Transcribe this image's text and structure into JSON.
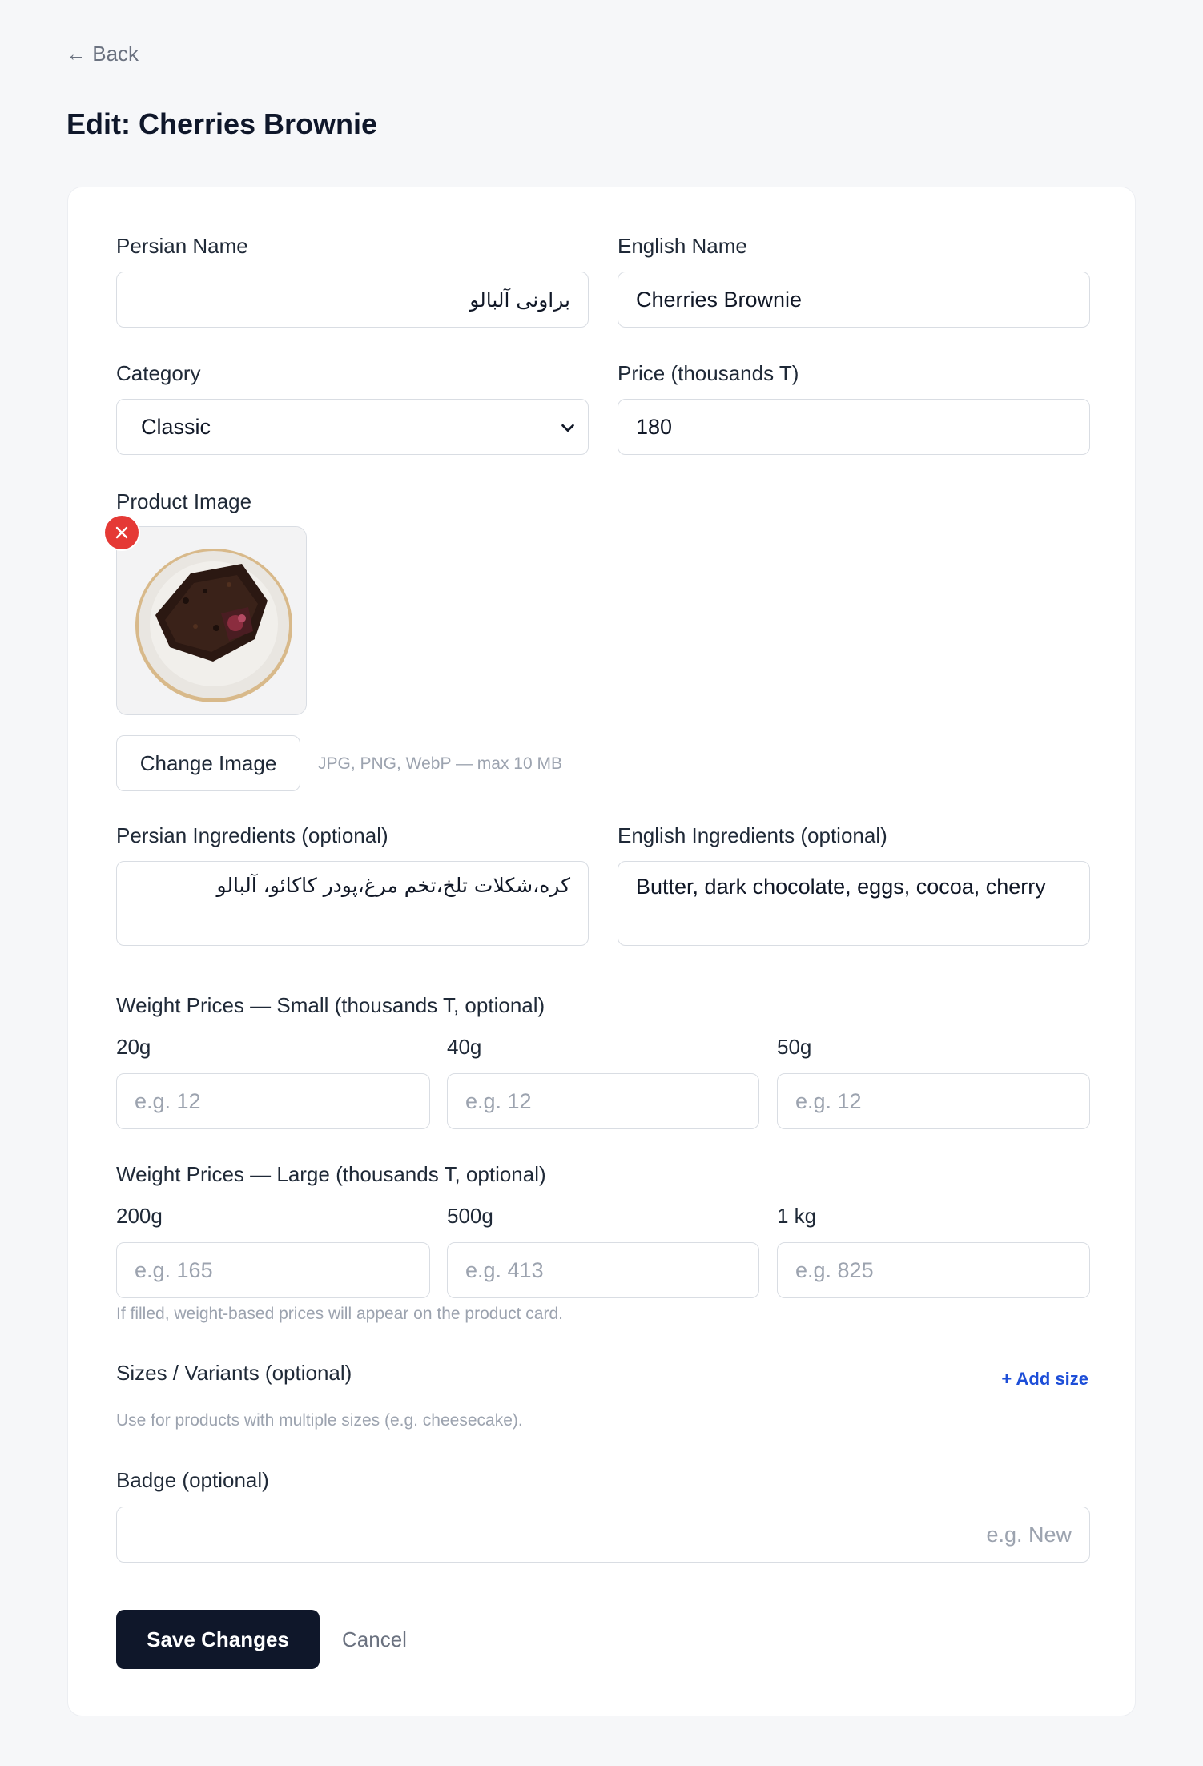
{
  "nav": {
    "back_label": "← Back"
  },
  "page": {
    "title": "Edit: Cherries Brownie"
  },
  "form": {
    "persian_name": {
      "label": "Persian Name",
      "value": "براونی آلبالو"
    },
    "english_name": {
      "label": "English Name",
      "value": "Cherries Brownie"
    },
    "category": {
      "label": "Category",
      "value": "Classic"
    },
    "price": {
      "label": "Price (thousands T)",
      "value": "180"
    },
    "product_image": {
      "label": "Product Image",
      "change_button": "Change Image",
      "hint": "JPG, PNG, WebP — max 10 MB"
    },
    "persian_ingredients": {
      "label": "Persian Ingredients (optional)",
      "value": "کره،شکلات تلخ،تخم مرغ،پودر کاکائو، آلبالو"
    },
    "english_ingredients": {
      "label": "English Ingredients (optional)",
      "value": "Butter, dark chocolate, eggs, cocoa, cherry"
    },
    "weight_small": {
      "label": "Weight Prices — Small (thousands T, optional)",
      "fields": [
        {
          "label": "20g",
          "placeholder": "e.g. 12"
        },
        {
          "label": "40g",
          "placeholder": "e.g. 12"
        },
        {
          "label": "50g",
          "placeholder": "e.g. 12"
        }
      ]
    },
    "weight_large": {
      "label": "Weight Prices — Large (thousands T, optional)",
      "fields": [
        {
          "label": "200g",
          "placeholder": "e.g. 165"
        },
        {
          "label": "500g",
          "placeholder": "e.g. 413"
        },
        {
          "label": "1 kg",
          "placeholder": "e.g. 825"
        }
      ],
      "hint": "If filled, weight-based prices will appear on the product card."
    },
    "sizes": {
      "label": "Sizes / Variants (optional)",
      "add_label": "+ Add size",
      "hint": "Use for products with multiple sizes (e.g. cheesecake)."
    },
    "badge": {
      "label": "Badge (optional)",
      "placeholder": "e.g. New"
    }
  },
  "actions": {
    "save_label": "Save Changes",
    "cancel_label": "Cancel"
  },
  "colors": {
    "primary": "#0f172a",
    "link": "#1d4ed8",
    "danger": "#e53935"
  }
}
